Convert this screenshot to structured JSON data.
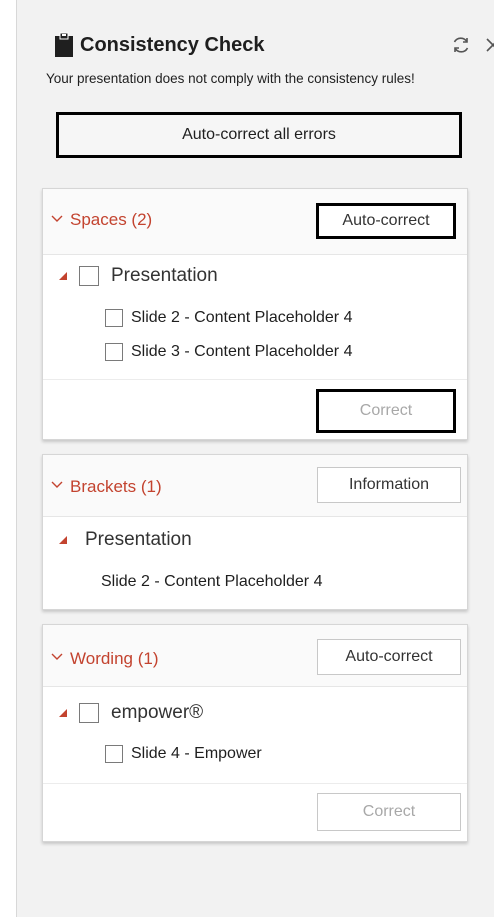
{
  "header": {
    "title": "Consistency Check",
    "icons": [
      "clipboard-icon",
      "refresh-icon",
      "close-icon"
    ]
  },
  "warning": "Your presentation does not comply with the consistency rules!",
  "auto_correct_all_label": "Auto-correct all errors",
  "groups": [
    {
      "name": "Spaces (2)",
      "action_label": "Auto-correct",
      "root": "Presentation",
      "items": [
        "Slide 2 - Content Placeholder 4",
        "Slide 3 - Content Placeholder 4"
      ],
      "footer_label": "Correct"
    },
    {
      "name": "Brackets (1)",
      "action_label": "Information",
      "root": "Presentation",
      "items": [
        "Slide 2 - Content Placeholder 4"
      ]
    },
    {
      "name": "Wording (1)",
      "action_label": "Auto-correct",
      "root": "empower®",
      "items": [
        "Slide 4 - Empower"
      ],
      "footer_label": "Correct"
    }
  ],
  "colors": {
    "category": "#c3432f",
    "panel_bg": "#f2f2f2",
    "disabled_text": "#a8a8a8"
  }
}
